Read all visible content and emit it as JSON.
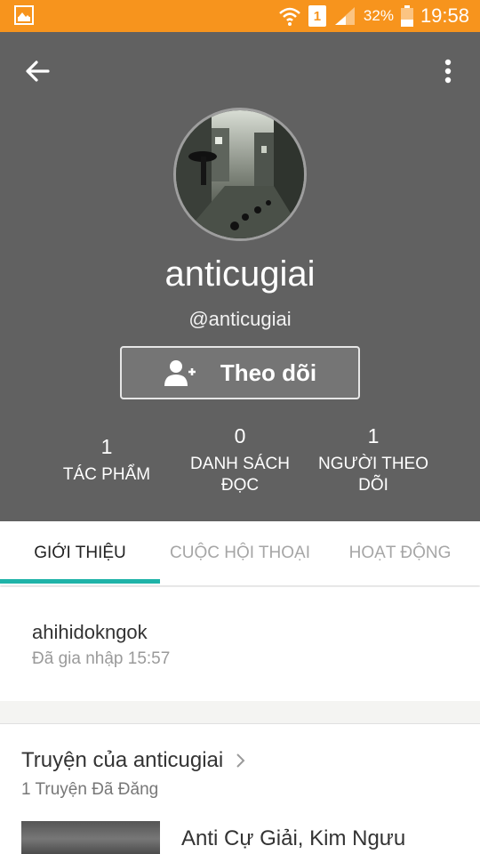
{
  "status_bar": {
    "sim": "1",
    "battery": "32%",
    "time": "19:58"
  },
  "profile": {
    "name": "anticugiai",
    "handle": "@anticugiai",
    "follow_label": "Theo dõi",
    "stats": [
      {
        "value": "1",
        "label": "TÁC PHẨM"
      },
      {
        "value": "0",
        "label": "DANH SÁCH ĐỌC"
      },
      {
        "value": "1",
        "label": "NGƯỜI THEO DÕI"
      }
    ]
  },
  "tabs": [
    "GIỚI THIỆU",
    "CUỘC HỘI THOẠI",
    "HOẠT ĐỘNG"
  ],
  "about": {
    "text": "ahihidokngok",
    "joined": "Đã gia nhập 15:57"
  },
  "stories": {
    "title": "Truyện của anticugiai",
    "count": "1 Truyện Đã Đăng",
    "items": [
      {
        "title": "Anti Cự Giải, Kim Ngưu"
      }
    ]
  },
  "colors": {
    "status_bar": "#f7941d",
    "header": "#616161",
    "tab_indicator": "#1fb3a8"
  }
}
